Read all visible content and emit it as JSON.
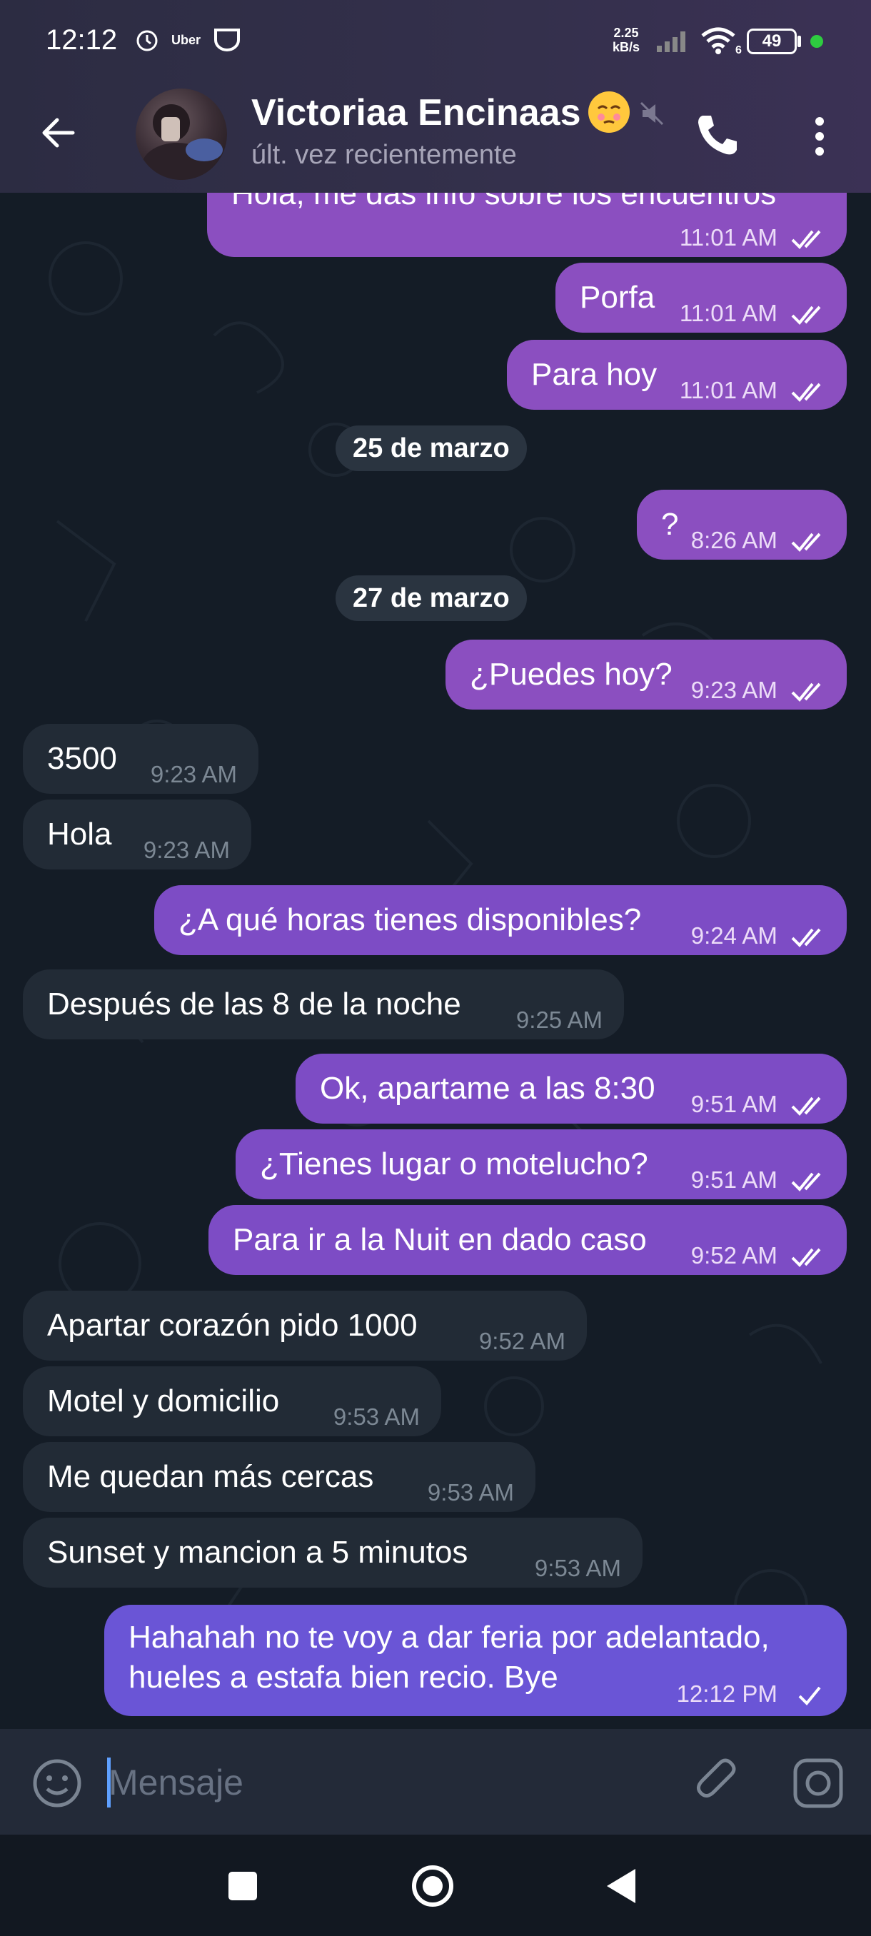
{
  "status_bar": {
    "time": "12:12",
    "notif_label": "Uber",
    "net_speed_value": "2.25",
    "net_speed_unit": "kB/s",
    "wifi_level": "6",
    "battery": "49"
  },
  "header": {
    "name": "Victoriaa Encinaas",
    "status": "últ. vez recientemente"
  },
  "messages": [
    {
      "type": "out",
      "text": "Hola, me das info sobre los encuentros",
      "time": "11:01 AM",
      "read": true
    },
    {
      "type": "out",
      "text": "Porfa",
      "time": "11:01 AM",
      "read": true
    },
    {
      "type": "out",
      "text": "Para hoy",
      "time": "11:01 AM",
      "read": true
    },
    {
      "type": "date",
      "text": "25 de marzo"
    },
    {
      "type": "out",
      "text": "?",
      "time": "8:26 AM",
      "read": true
    },
    {
      "type": "date",
      "text": "27 de marzo"
    },
    {
      "type": "out",
      "text": "¿Puedes hoy?",
      "time": "9:23 AM",
      "read": true
    },
    {
      "type": "in",
      "text": "3500",
      "time": "9:23 AM"
    },
    {
      "type": "in",
      "text": "Hola",
      "time": "9:23 AM"
    },
    {
      "type": "out",
      "text": "¿A qué horas tienes disponibles?",
      "time": "9:24 AM",
      "read": true
    },
    {
      "type": "in",
      "text": "Después de las 8 de la noche",
      "time": "9:25 AM"
    },
    {
      "type": "out",
      "text": "Ok, apartame a las 8:30",
      "time": "9:51 AM",
      "read": true
    },
    {
      "type": "out",
      "text": "¿Tienes lugar o motelucho?",
      "time": "9:51 AM",
      "read": true
    },
    {
      "type": "out",
      "text": "Para ir a la Nuit en dado caso",
      "time": "9:52 AM",
      "read": true
    },
    {
      "type": "in",
      "text": "Apartar corazón pido 1000",
      "time": "9:52 AM"
    },
    {
      "type": "in",
      "text": "Motel y domicilio",
      "time": "9:53 AM"
    },
    {
      "type": "in",
      "text": "Me quedan más cercas",
      "time": "9:53 AM"
    },
    {
      "type": "in",
      "text": "Sunset y mancion a 5 minutos",
      "time": "9:53 AM"
    },
    {
      "type": "out",
      "text_line1": "Hahahah no te voy a dar feria por adelantado,",
      "text_line2": "hueles a estafa bien recio. Bye",
      "time": "12:12 PM",
      "read": false
    }
  ],
  "input": {
    "placeholder": "Mensaje"
  },
  "colors": {
    "outgoing_bubble": "#8b4fc0",
    "incoming_bubble": "#222b36",
    "chat_background": "#141c26",
    "input_cursor": "#5fa0ff"
  },
  "icons": [
    "back-arrow-icon",
    "mute-icon",
    "phone-icon",
    "more-vert-icon",
    "emoji-icon",
    "attach-icon",
    "camera-icon",
    "double-check-icon",
    "single-check-icon",
    "alarm-icon",
    "uber-icon",
    "signal-icon",
    "wifi-icon",
    "battery-icon"
  ]
}
